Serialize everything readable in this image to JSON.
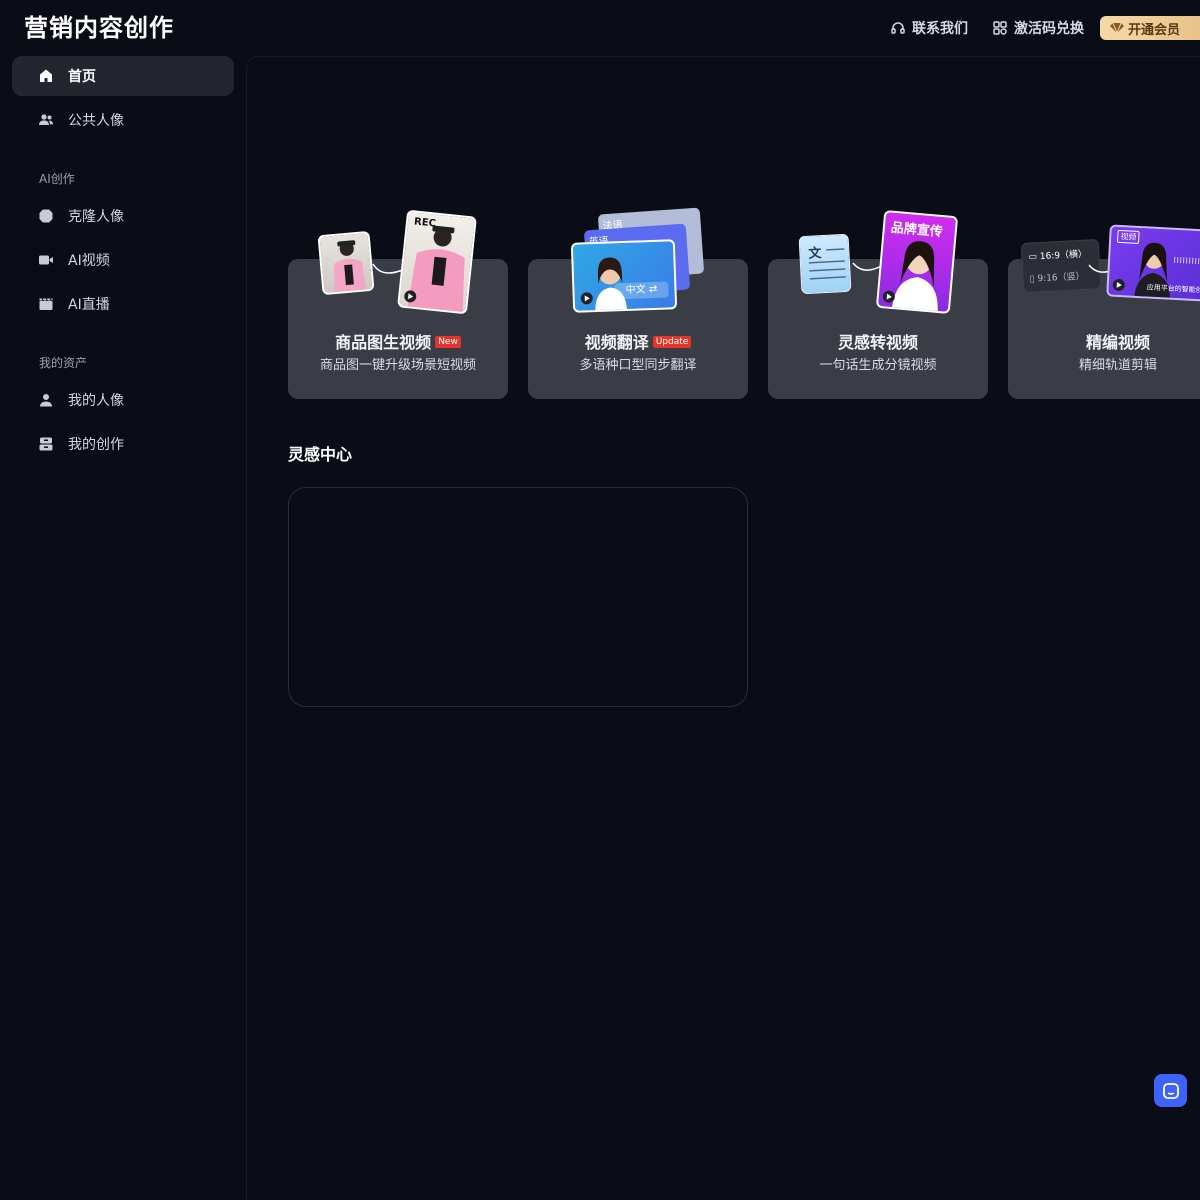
{
  "app": {
    "logo": "营销内容创作"
  },
  "header": {
    "contact": "联系我们",
    "redeem": "激活码兑换",
    "vip": "开通会员"
  },
  "sidebar": {
    "items": [
      {
        "label": "首页",
        "icon": "home-icon",
        "active": true
      },
      {
        "label": "公共人像",
        "icon": "users-icon"
      }
    ],
    "section_ai": "AI创作",
    "ai_items": [
      {
        "label": "克隆人像",
        "icon": "clone-icon"
      },
      {
        "label": "AI视频",
        "icon": "video-camera-icon"
      },
      {
        "label": "AI直播",
        "icon": "clapper-icon"
      }
    ],
    "section_assets": "我的资产",
    "asset_items": [
      {
        "label": "我的人像",
        "icon": "user-icon"
      },
      {
        "label": "我的创作",
        "icon": "archive-icon"
      }
    ]
  },
  "cards": [
    {
      "title": "商品图生视频",
      "badge": "New",
      "subtitle": "商品图一键升级场景短视频",
      "thumb_text": "REC"
    },
    {
      "title": "视频翻译",
      "badge": "Update",
      "subtitle": "多语种口型同步翻译",
      "tags": [
        "法语",
        "英语",
        "中文"
      ]
    },
    {
      "title": "灵感转视频",
      "subtitle": "一句话生成分镜视频",
      "doc_char": "文",
      "banner": "品牌宣传"
    },
    {
      "title": "精编视频",
      "subtitle": "精细轨道剪辑",
      "ratios": [
        "16:9（横）",
        "9:16（竖）"
      ],
      "video_tag": "视频",
      "caption": "应用平台的智能创作"
    }
  ],
  "inspiration": {
    "title": "灵感中心"
  },
  "colors": {
    "accent": "#3d63ff",
    "badge": "#e5352b",
    "vip": "#f5d9a8"
  }
}
